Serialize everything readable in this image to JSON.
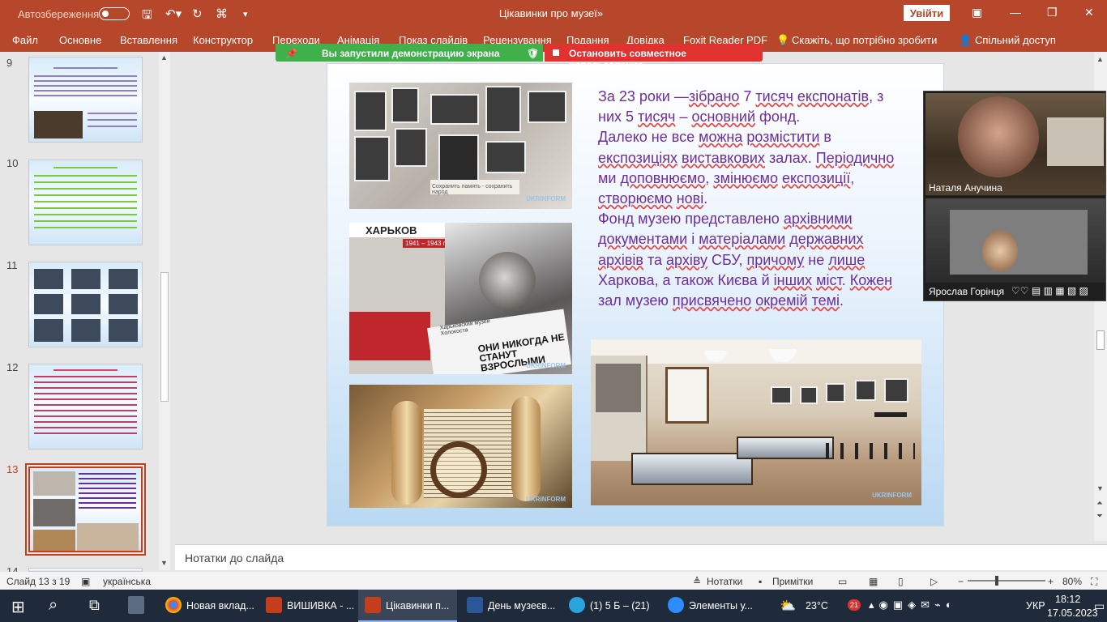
{
  "titlebar": {
    "autosave": "Автозбереження",
    "title": "Цікавинки про музеї»",
    "signin": "Увійти",
    "bg": "#b7472a"
  },
  "ribbon": {
    "tabs": [
      "Файл",
      "Основне",
      "Вставлення",
      "Конструктор",
      "Переходи",
      "Анімація",
      "Показ слайдів",
      "Рецензування",
      "Подання",
      "Довідка",
      "Foxit Reader PDF"
    ],
    "tell_me": "Скажіть, що потрібно зробити",
    "share": "Спільний доступ"
  },
  "sharing": {
    "started": "Вы запустили демонстрацию экрана",
    "stop": "Остановить совместное использование"
  },
  "thumbnails": {
    "numbers": [
      "9",
      "10",
      "11",
      "12",
      "13",
      "14"
    ],
    "selected": "13"
  },
  "slide": {
    "text": {
      "l1a": "За 23 роки —",
      "l1b": "зібрано",
      "l1c": " 7 ",
      "l1d": "тисяч",
      "l1e": " ",
      "l1f": "експонатів",
      "l1g": ", з",
      "l2a": "них 5 ",
      "l2b": "тисяч",
      "l2c": " – ",
      "l2d": "основний",
      "l2e": " фонд.",
      "l3a": " Далеко не все ",
      "l3b": "можна",
      "l3c": " ",
      "l3d": "розмістити",
      "l3e": " в",
      "l4a": "експозиціях",
      "l4b": " ",
      "l4c": "виставкових",
      "l4d": " залах. ",
      "l4e": "Періодично",
      "l5a": "ми ",
      "l5b": "доповнюємо",
      "l5c": ", ",
      "l5d": "змінюємо",
      "l5e": " ",
      "l5f": "експозиції",
      "l5g": ",",
      "l6a": "створюємо",
      "l6b": " ",
      "l6c": "нові",
      "l6d": ".",
      "l7a": "Фонд музею представлено ",
      "l7b": "архівними",
      "l8a": "документами",
      "l8b": " і ",
      "l8c": "матеріалами",
      "l8d": " ",
      "l8e": "державних",
      "l9a": "архівів",
      "l9b": " та ",
      "l9c": "архіву",
      "l9d": " СБУ, ",
      "l9e": "причому",
      "l9f": " не ",
      "l9g": "лише",
      "l10a": "Харкова, а також Києва й ",
      "l10b": "інших",
      "l10c": " ",
      "l10d": "міст",
      "l10e": ". ",
      "l10f": "Кожен",
      "l11a": "зал музею ",
      "l11b": "присвячено",
      "l11c": " ",
      "l11d": "окремій",
      "l11e": " ",
      "l11f": "темі",
      "l11g": "."
    },
    "watermark": "UKRINFORM",
    "poster_title": "ХАРЬКОВ",
    "poster_years": "1941 – 1943 гг.",
    "poster_slogan": "ОНИ НИКОГДА НЕ СТАНУТ ВЗРОСЛЫМИ",
    "poster_museum": "Харьковский музей Холокоста",
    "plaque": "Сохранить память - сохранить народ",
    "text_color": "#6c2e9c"
  },
  "video": {
    "participant1": "Наталя Анучина",
    "participant2": "Ярослав Горінця"
  },
  "notes": {
    "placeholder": "Нотатки до слайда"
  },
  "status": {
    "slide_info": "Слайд 13 з 19",
    "language": "українська",
    "notes_btn": "Нотатки",
    "comments_btn": "Примітки",
    "zoom": "80%"
  },
  "taskbar": {
    "items": [
      {
        "label": "Новая вклад..."
      },
      {
        "label": "ВИШИВКА - ..."
      },
      {
        "label": "Цікавинки п..."
      },
      {
        "label": "День музеєв..."
      },
      {
        "label": "(1) 5 Б – (21)"
      },
      {
        "label": "Элементы у..."
      }
    ],
    "weather": "23°C",
    "lang": "УКР",
    "time": "18:12",
    "date": "17.05.2023",
    "badge": "21"
  }
}
